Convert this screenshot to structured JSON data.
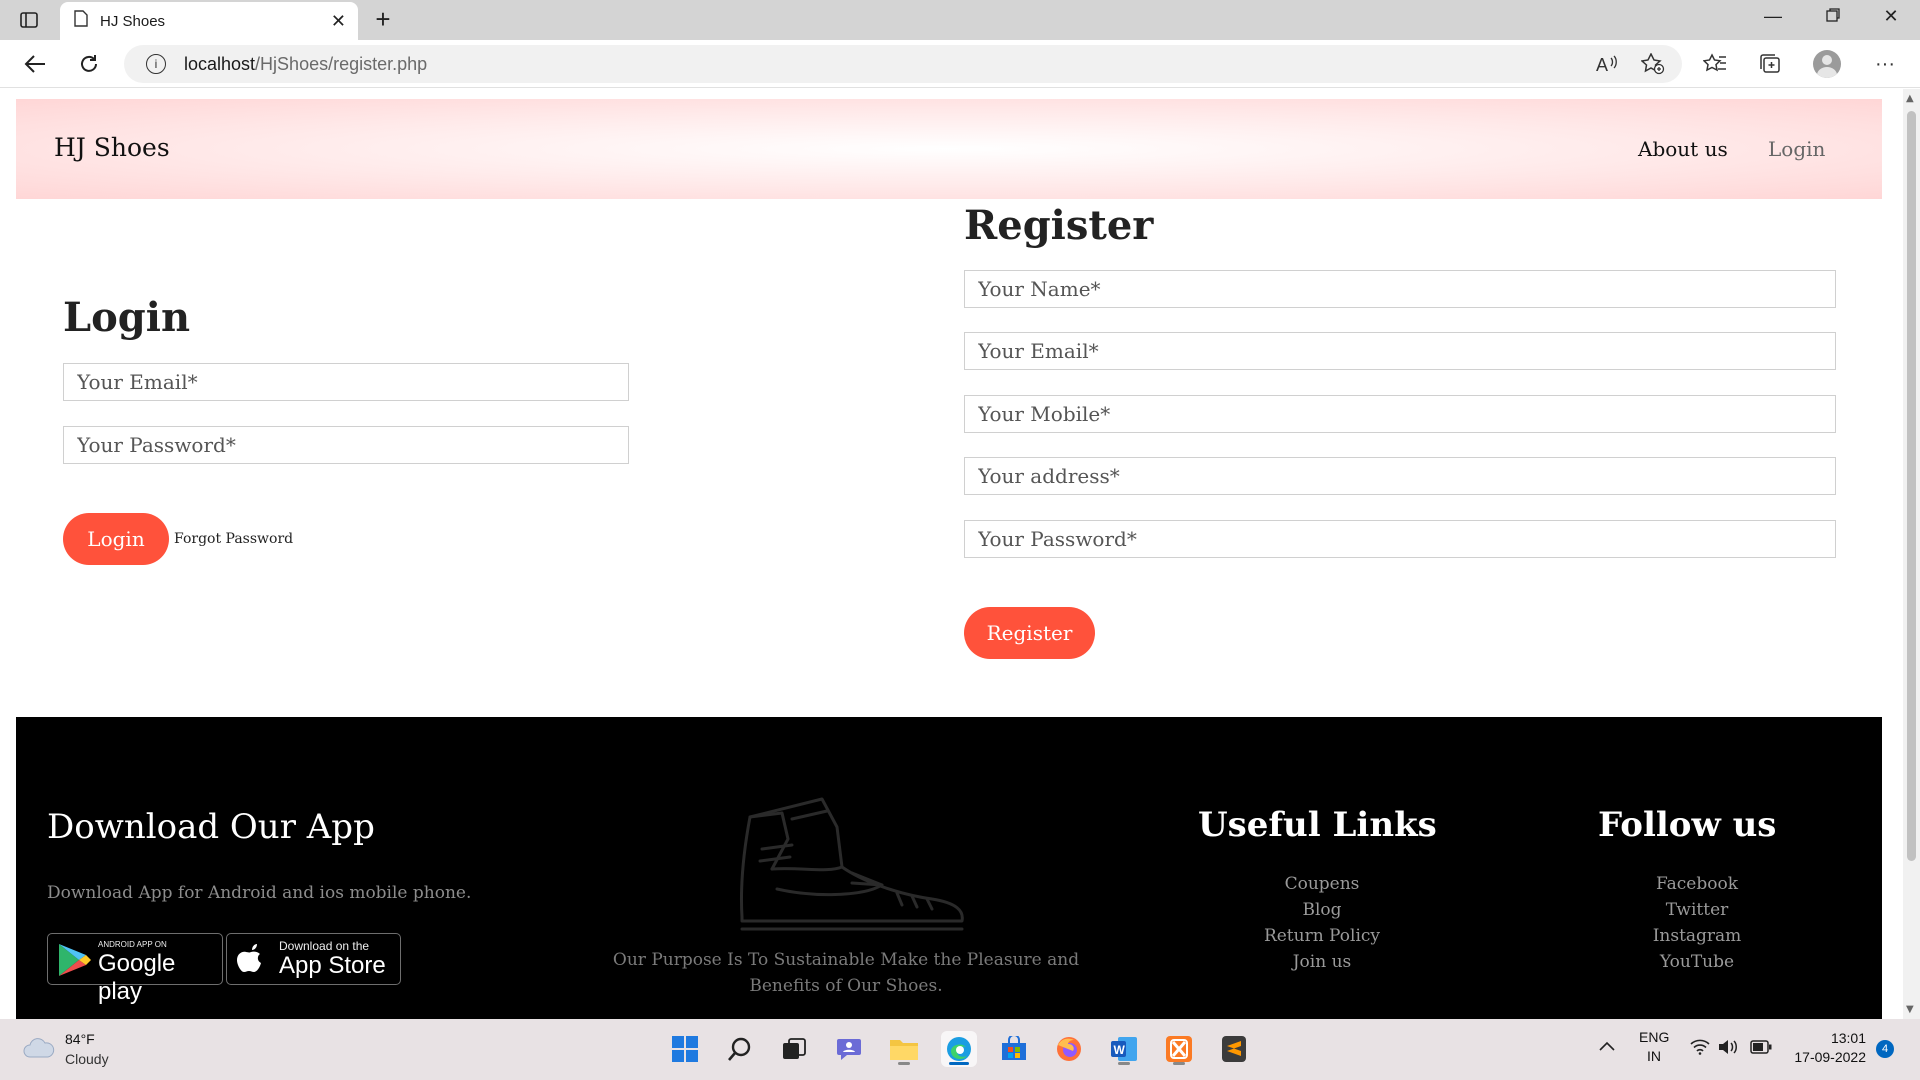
{
  "browser": {
    "tab_title": "HJ Shoes",
    "url_host": "localhost",
    "url_path": "/HjShoes/register.php"
  },
  "site": {
    "brand": "HJ Shoes",
    "nav": {
      "about": "About us",
      "login": "Login"
    }
  },
  "login": {
    "title": "Login",
    "email_placeholder": "Your Email*",
    "password_placeholder": "Your Password*",
    "submit_label": "Login",
    "forgot_label": "Forgot Password"
  },
  "register": {
    "title": "Register",
    "name_placeholder": "Your Name*",
    "email_placeholder": "Your Email*",
    "mobile_placeholder": "Your Mobile*",
    "address_placeholder": "Your address*",
    "password_placeholder": "Your Password*",
    "submit_label": "Register"
  },
  "footer": {
    "app_title": "Download Our App",
    "app_text": "Download App for Android and ios mobile phone.",
    "google_play_small": "ANDROID APP ON",
    "google_play_big": "Google play",
    "app_store_small": "Download on the",
    "app_store_big": "App Store",
    "purpose": "Our Purpose Is To Sustainable Make the Pleasure and Benefits of Our Shoes.",
    "useful_title": "Useful Links",
    "useful_links": [
      "Coupens",
      "Blog",
      "Return Policy",
      "Join us"
    ],
    "follow_title": "Follow us",
    "follow_links": [
      "Facebook",
      "Twitter",
      "Instagram",
      "YouTube"
    ]
  },
  "taskbar": {
    "temperature": "84°F",
    "weather": "Cloudy",
    "lang_top": "ENG",
    "lang_bottom": "IN",
    "time": "13:01",
    "date": "17-09-2022",
    "notifications": "4"
  },
  "colors": {
    "accent": "#ff523b",
    "footer_bg": "#000000",
    "nav_gradient_edge": "#ffd6d6"
  }
}
